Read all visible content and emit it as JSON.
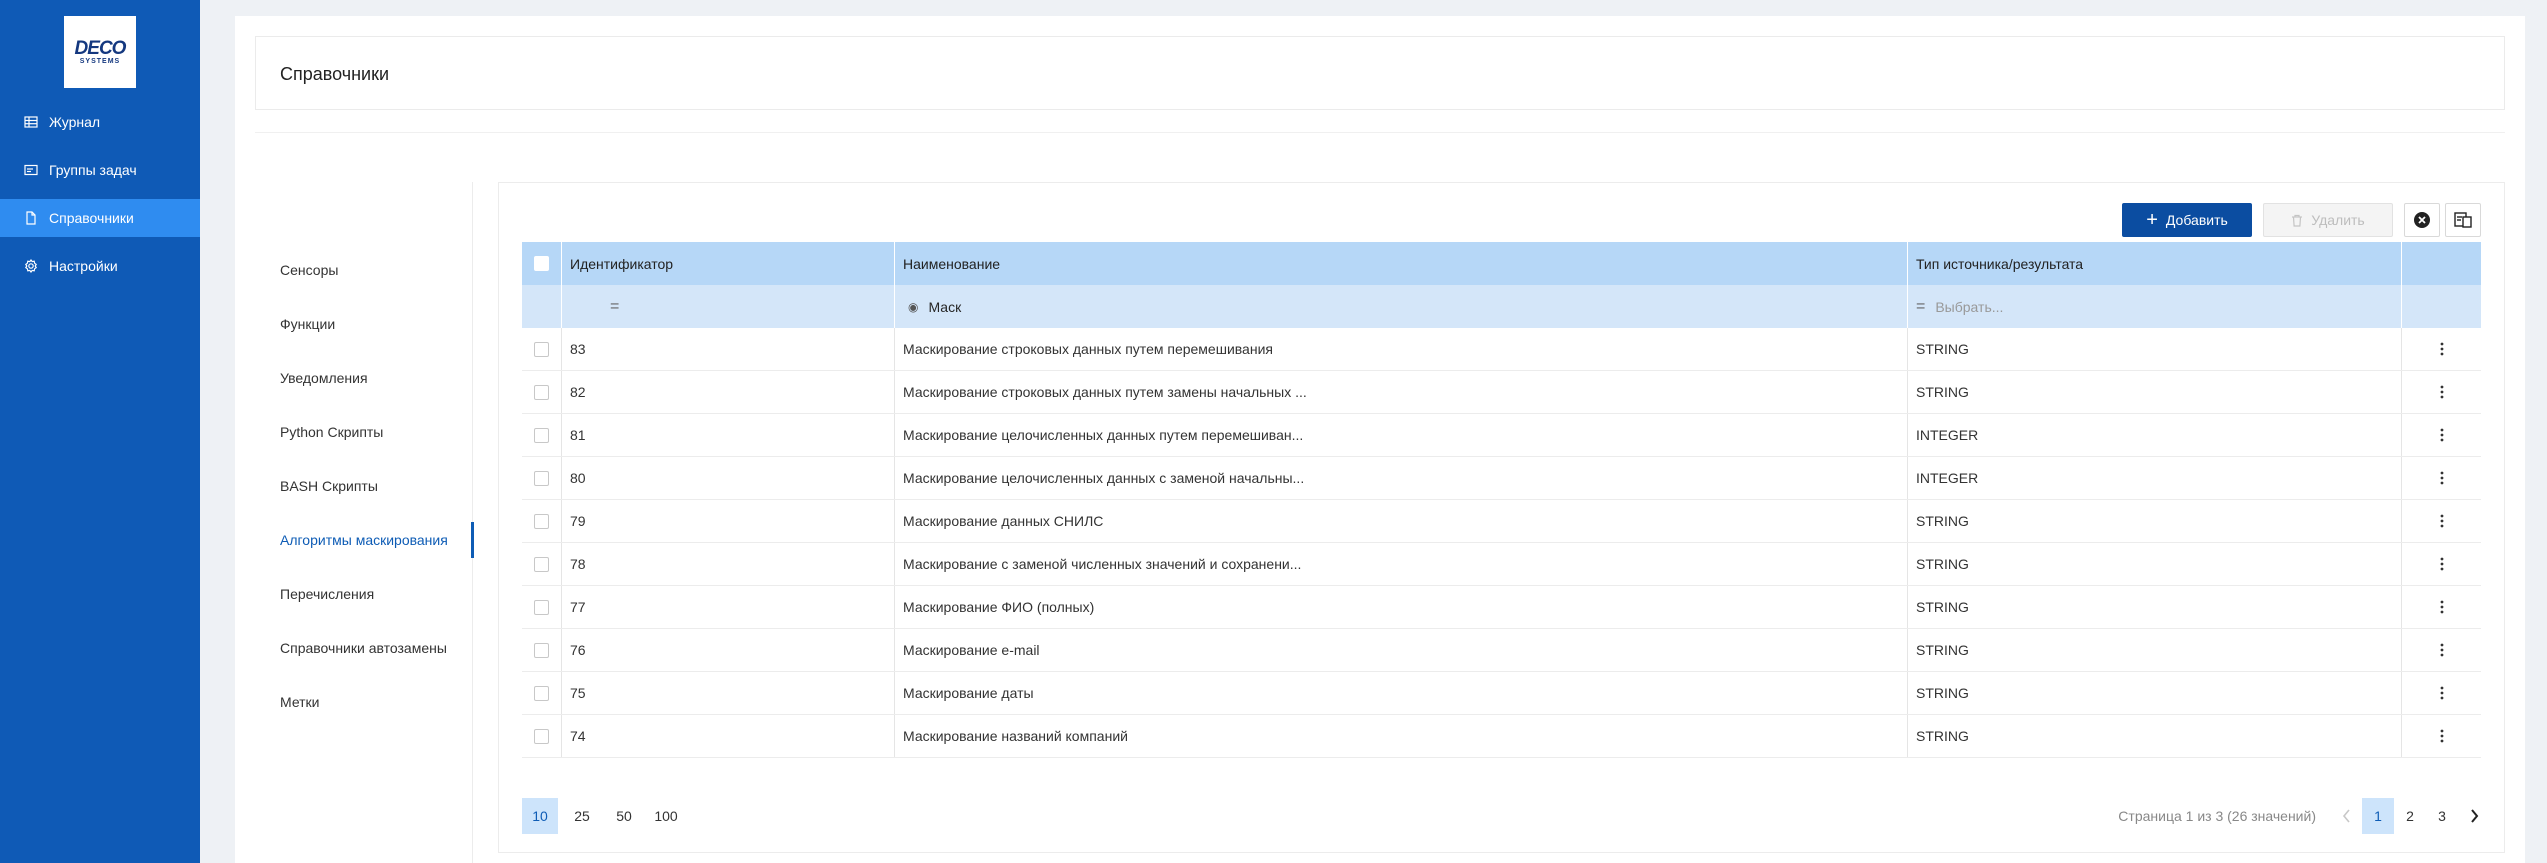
{
  "logo": {
    "line1": "DECO",
    "line2": "SYSTEMS"
  },
  "nav": [
    {
      "label": "Журнал",
      "icon": "table-icon"
    },
    {
      "label": "Группы задач",
      "icon": "card-icon"
    },
    {
      "label": "Справочники",
      "icon": "file-icon",
      "active": true
    },
    {
      "label": "Настройки",
      "icon": "gear-icon"
    }
  ],
  "page": {
    "title": "Справочники"
  },
  "submenu": [
    "Сенсоры",
    "Функции",
    "Уведомления",
    "Python Скрипты",
    "BASH Скрипты",
    "Алгоритмы маскирования",
    "Перечисления",
    "Справочники автозамены",
    "Метки"
  ],
  "toolbar": {
    "add_label": "Добавить",
    "delete_label": "Удалить"
  },
  "table": {
    "columns": [
      "Идентификатор",
      "Наименование",
      "Тип источника/результата"
    ],
    "filters": {
      "id_operator": "=",
      "name_value": "Маск",
      "type_operator": "=",
      "type_placeholder": "Выбрать..."
    },
    "rows": [
      {
        "id": "83",
        "name": "Маскирование строковых данных путем перемешивания",
        "type": "STRING"
      },
      {
        "id": "82",
        "name": "Маскирование строковых данных путем замены начальных ...",
        "type": "STRING"
      },
      {
        "id": "81",
        "name": "Маскирование целочисленных данных путем перемешиван...",
        "type": "INTEGER"
      },
      {
        "id": "80",
        "name": "Маскирование целочисленных данных с заменой начальны...",
        "type": "INTEGER"
      },
      {
        "id": "79",
        "name": "Маскирование данных СНИЛС",
        "type": "STRING"
      },
      {
        "id": "78",
        "name": "Маскирование с заменой численных значений и сохранени...",
        "type": "STRING"
      },
      {
        "id": "77",
        "name": "Маскирование ФИО (полных)",
        "type": "STRING"
      },
      {
        "id": "76",
        "name": "Маскирование e-mail",
        "type": "STRING"
      },
      {
        "id": "75",
        "name": "Маскирование даты",
        "type": "STRING"
      },
      {
        "id": "74",
        "name": "Маскирование названий компаний",
        "type": "STRING"
      }
    ]
  },
  "pagination": {
    "sizes": [
      "10",
      "25",
      "50",
      "100"
    ],
    "info": "Страница 1 из 3 (26 значений)",
    "pages": [
      "1",
      "2",
      "3"
    ]
  }
}
